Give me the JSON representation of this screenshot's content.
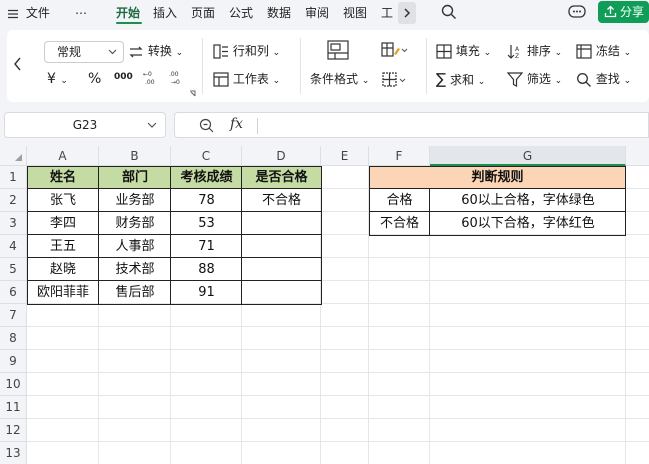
{
  "menubar": {
    "file_label": "文件",
    "more_label": "⋯",
    "tabs": [
      {
        "label": "开始",
        "active": true
      },
      {
        "label": "插入"
      },
      {
        "label": "页面"
      },
      {
        "label": "公式"
      },
      {
        "label": "数据"
      },
      {
        "label": "审阅"
      },
      {
        "label": "视图"
      },
      {
        "label": "工"
      }
    ],
    "share_label": "分享"
  },
  "ribbon": {
    "number_format": "常规",
    "convert_label": "转换",
    "currency_symbol": "¥",
    "percent_symbol": "%",
    "thousands_symbol": "000",
    "row_col_label": "行和列",
    "worksheet_label": "工作表",
    "cond_format_label": "条件格式",
    "fill_label": "填充",
    "sort_label": "排序",
    "freeze_label": "冻结",
    "sum_label": "求和",
    "filter_label": "筛选",
    "find_label": "查找"
  },
  "formula_bar": {
    "name_box": "G23",
    "fx_label": "fx",
    "value": ""
  },
  "sheet": {
    "columns": [
      "A",
      "B",
      "C",
      "D",
      "E",
      "F",
      "G"
    ],
    "rows": [
      "1",
      "2",
      "3",
      "4",
      "5",
      "6",
      "7",
      "8",
      "9",
      "10",
      "11",
      "12",
      "13"
    ],
    "table_headers": [
      "姓名",
      "部门",
      "考核成绩",
      "是否合格"
    ],
    "table_rows": [
      [
        "张飞",
        "业务部",
        "78",
        "不合格"
      ],
      [
        "李四",
        "财务部",
        "53",
        ""
      ],
      [
        "王五",
        "人事部",
        "71",
        ""
      ],
      [
        "赵晓",
        "技术部",
        "88",
        ""
      ],
      [
        "欧阳菲菲",
        "售后部",
        "91",
        ""
      ]
    ],
    "rules_title": "判断规则",
    "rules": [
      [
        "合格",
        "60以上合格，字体绿色"
      ],
      [
        "不合格",
        "60以下合格，字体红色"
      ]
    ]
  },
  "colors": {
    "accent_green": "#1d8f4e",
    "share_green": "#0f9d58",
    "header_green": "#c4dba4",
    "header_orange": "#fbd5b5"
  }
}
